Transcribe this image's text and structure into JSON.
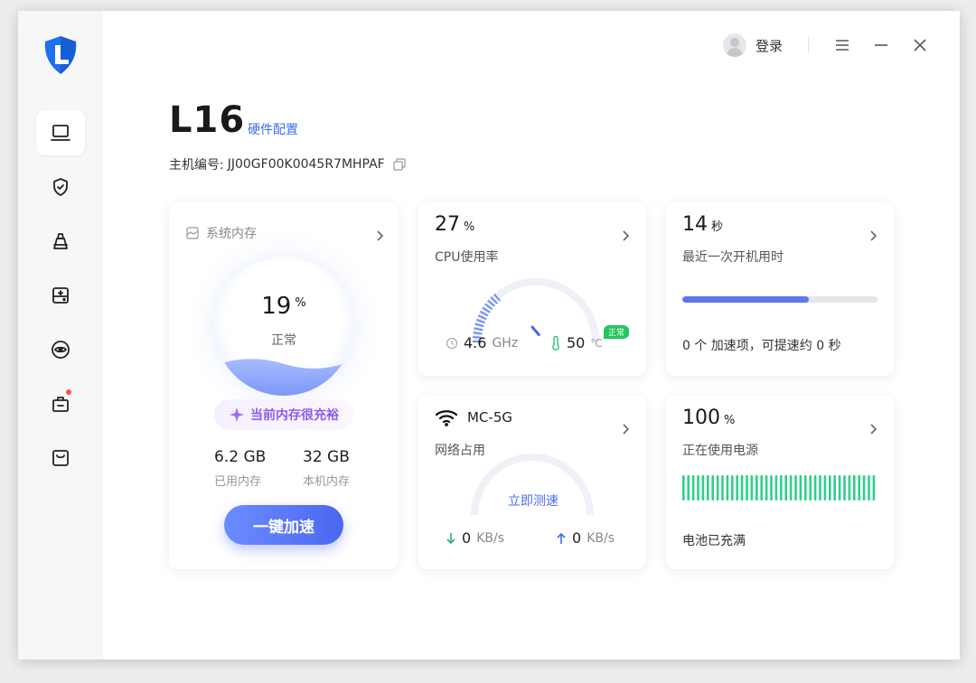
{
  "sidebar": {
    "items": [
      {
        "icon": "laptop-icon",
        "active": true
      },
      {
        "icon": "shield-check-icon",
        "active": false
      },
      {
        "icon": "broom-icon",
        "active": false
      },
      {
        "icon": "disk-icon",
        "active": false
      },
      {
        "icon": "eye-icon",
        "active": false
      },
      {
        "icon": "toolbox-icon",
        "active": false,
        "badge": true
      },
      {
        "icon": "store-icon",
        "active": false
      }
    ]
  },
  "titlebar": {
    "login_label": "登录"
  },
  "header": {
    "device_name": "L16",
    "hardware_link": "硬件配置",
    "serial_label": "主机编号:",
    "serial_value": "JJ00GF00K0045R7MHPAF"
  },
  "memory": {
    "title": "系统内存",
    "percent": "19",
    "percent_unit": "%",
    "status": "正常",
    "badge": "当前内存很充裕",
    "used_value": "6.2 GB",
    "used_label": "已用内存",
    "total_value": "32 GB",
    "total_label": "本机内存",
    "boost_button": "一键加速"
  },
  "cpu": {
    "percent": "27",
    "percent_unit": "%",
    "title": "CPU使用率",
    "freq_value": "4.6",
    "freq_unit": "GHz",
    "temp_value": "50",
    "temp_unit": "℃",
    "temp_badge": "正常",
    "usage_fraction": 0.27
  },
  "boot": {
    "value": "14",
    "unit": "秒",
    "title": "最近一次开机用时",
    "progress_fraction": 0.65,
    "tip": "0 个 加速项，可提速约 0 秒"
  },
  "network": {
    "ssid": "MC-5G",
    "title": "网络占用",
    "speed_test": "立即测速",
    "down_value": "0",
    "down_unit": "KB/s",
    "up_value": "0",
    "up_unit": "KB/s"
  },
  "battery": {
    "percent": "100",
    "percent_unit": "%",
    "title": "正在使用电源",
    "level_fraction": 1.0,
    "tip": "电池已充满"
  },
  "colors": {
    "accent": "#4c67f0",
    "link": "#3b6ef5",
    "progress": "#5b79ea",
    "battery_bar": "#2fcf8a",
    "ok_badge": "#22c55e"
  }
}
